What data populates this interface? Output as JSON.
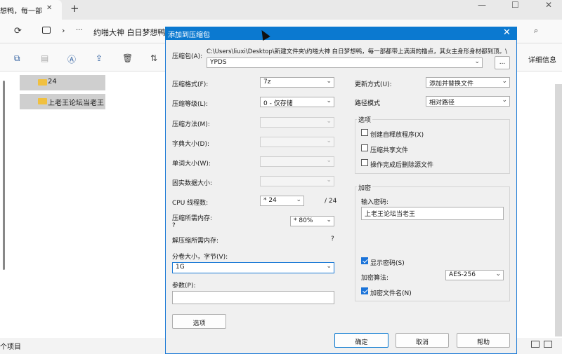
{
  "browser": {
    "tab_title": "想鸭，每一部",
    "tab_close": "✕",
    "new_tab": "+",
    "minimize": "—",
    "maximize": "☐",
    "close": "✕"
  },
  "explorer": {
    "address_more": "···",
    "address_path": "约啪大神 白日梦想鸭",
    "details_label": "详细信息",
    "folders": [
      "24",
      "上老王论坛当老王"
    ],
    "status": "个项目"
  },
  "dialog": {
    "title": "添加到压缩包",
    "archive_label": "压缩包(A):",
    "archive_path": "C:\\Users\\liuxi\\Desktop\\新建文件夹\\约啪大神 白日梦想鸭，每一部都带上满满的撸点，其女主身形身材都到顶。\\",
    "archive_name": "YPDS",
    "browse_button": "...",
    "format_label": "压缩格式(F):",
    "format_value": "7z",
    "level_label": "压缩等级(L):",
    "level_value": "0 - 仅存储",
    "method_label": "压缩方法(M):",
    "dict_label": "字典大小(D):",
    "word_label": "单词大小(W):",
    "solid_label": "固实数据大小:",
    "threads_label": "CPU 线程数:",
    "threads_value": "* 24",
    "threads_max": "/ 24",
    "mem_label": "压缩所需内存:",
    "mem_q": "?",
    "mem_value": "* 80%",
    "decomp_label": "解压缩所需内存:",
    "decomp_q": "?",
    "volume_label": "分卷大小，字节(V):",
    "volume_value": "1G",
    "params_label": "参数(P):",
    "options_button": "选项",
    "update_label": "更新方式(U):",
    "update_value": "添加并替换文件",
    "pathmode_label": "路径模式",
    "pathmode_value": "相对路径",
    "options_group": "选项",
    "opt_sfx": "创建自释放程序(X)",
    "opt_shared": "压缩共享文件",
    "opt_delete": "操作完成后删除源文件",
    "encrypt_group": "加密",
    "password_label": "输入密码:",
    "password_value": "上老王论坛当老王",
    "show_password": "显示密码(S)",
    "enc_method_label": "加密算法:",
    "enc_method_value": "AES-256",
    "encrypt_names": "加密文件名(N)",
    "ok_button": "确定",
    "cancel_button": "取消",
    "help_button": "帮助"
  }
}
